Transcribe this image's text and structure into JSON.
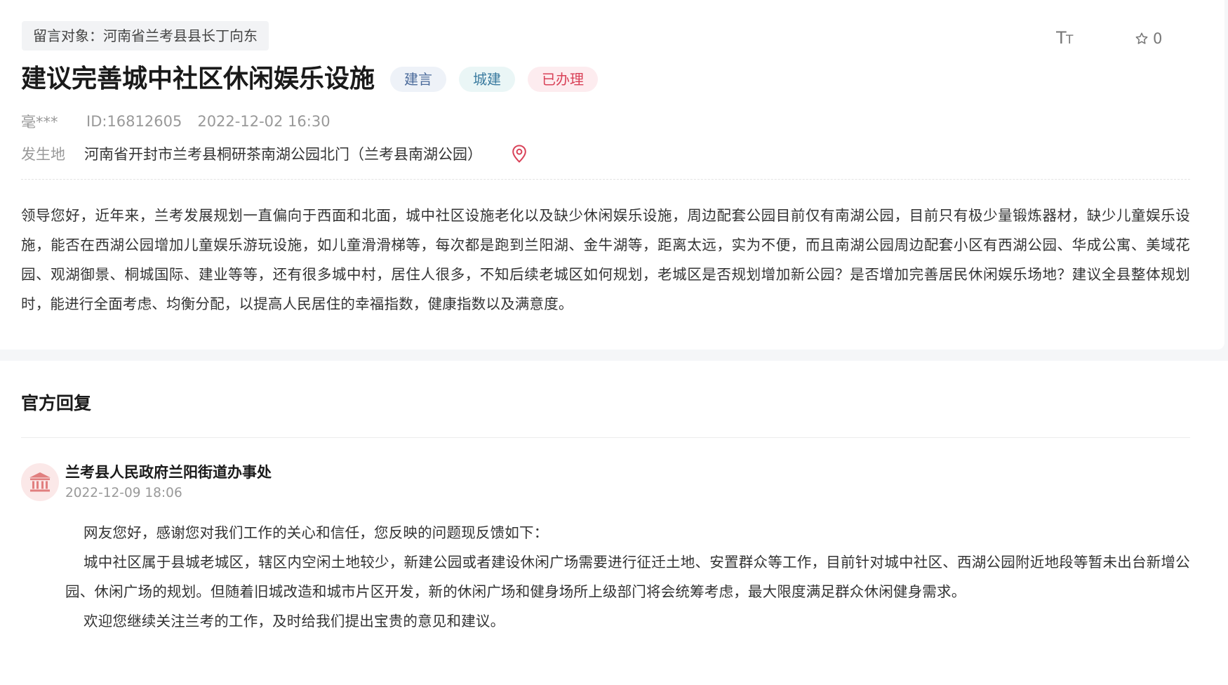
{
  "post": {
    "target": "留言对象：河南省兰考县县长丁向东",
    "title": "建议完善城中社区休闲娱乐设施",
    "tags": [
      {
        "label": "建言",
        "color": "#4a6a9a"
      },
      {
        "label": "城建",
        "color": "#3a7b9f"
      },
      {
        "label": "已办理",
        "color": "#d94258"
      }
    ],
    "author": "毫***",
    "id": "ID:16812605",
    "datetime": "2022-12-02 16:30",
    "location_label": "发生地",
    "location": "河南省开封市兰考县桐研茶南湖公园北门（兰考县南湖公园）",
    "content": "领导您好，近年来，兰考发展规划一直偏向于西面和北面，城中社区设施老化以及缺少休闲娱乐设施，周边配套公园目前仅有南湖公园，目前只有极少量锻炼器材，缺少儿童娱乐设施，能否在西湖公园增加儿童娱乐游玩设施，如儿童滑滑梯等，每次都是跑到兰阳湖、金牛湖等，距离太远，实为不便，而且南湖公园周边配套小区有西湖公园、华成公寓、美域花园、观湖御景、桐城国际、建业等等，还有很多城中村，居住人很多，不知后续老城区如何规划，老城区是否规划增加新公园？是否增加完善居民休闲娱乐场地？建议全县整体规划时，能进行全面考虑、均衡分配，以提高人民居住的幸福指数，健康指数以及满意度。"
  },
  "toolbar": {
    "font_icon": "font-size-icon",
    "fav_icon": "star-icon",
    "fav_count": "0"
  },
  "reply": {
    "heading": "官方回复",
    "org": "兰考县人民政府兰阳街道办事处",
    "org_icon": "government-building-icon",
    "datetime": "2022-12-09 18:06",
    "paragraphs": [
      "网友您好，感谢您对我们工作的关心和信任，您反映的问题现反馈如下：",
      "城中社区属于县城老城区，辖区内空闲土地较少，新建公园或者建设休闲广场需要进行征迁土地、安置群众等工作，目前针对城中社区、西湖公园附近地段等暂未出台新增公园、休闲广场的规划。但随着旧城改造和城市片区开发，新的休闲广场和健身场所上级部门将会统筹考虑，最大限度满足群众休闲健身需求。",
      "欢迎您继续关注兰考的工作，及时给我们提出宝贵的意见和建议。"
    ]
  },
  "colors": {
    "accent_red": "#d94258",
    "text_main": "#333333",
    "text_muted": "#999999"
  }
}
